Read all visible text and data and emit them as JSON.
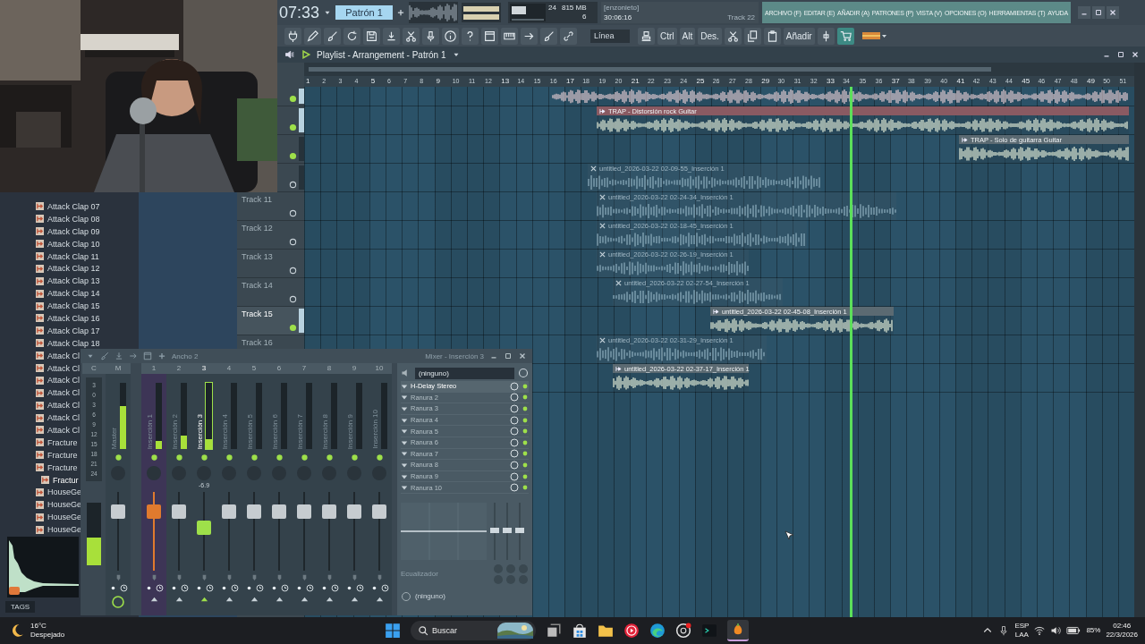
{
  "transport": {
    "time": "07:33",
    "pattern": "Patrón 1",
    "cpu": "24",
    "memory": "815 MB",
    "polyphony": "6"
  },
  "hint": {
    "user": "[enzonieto]",
    "time": "30:06:16",
    "track": "Track 22"
  },
  "menu": [
    "ARCHIVO (F)",
    "EDITAR (E)",
    "AÑADIR (A)",
    "PATRONES (P)",
    "VISTA (V)",
    "OPCIONES (O)",
    "HERRAMIENTAS (T)",
    "AYUDA"
  ],
  "toolbar": {
    "snap": "Línea",
    "buttons": [
      "Ctrl",
      "Alt",
      "Des.",
      "Añadir"
    ]
  },
  "playlist": {
    "title": "Playlist - Arrangement - Patrón 1",
    "ruler": [
      "1",
      "2",
      "3",
      "4",
      "5",
      "6",
      "7",
      "8",
      "9",
      "10",
      "11",
      "12",
      "13",
      "14",
      "15",
      "16",
      "17",
      "18",
      "19",
      "20",
      "21",
      "22",
      "23",
      "24",
      "25",
      "26",
      "27",
      "28",
      "29",
      "30",
      "31",
      "32",
      "33",
      "34",
      "35",
      "36",
      "37",
      "38",
      "39",
      "40",
      "41",
      "42",
      "43",
      "44",
      "45",
      "46",
      "47",
      "48",
      "49",
      "50",
      "51"
    ],
    "rows": [
      {
        "track": {
          "selected": true,
          "enabled": true
        },
        "clip": {
          "muted": false
        }
      },
      {
        "track": {
          "selected": true,
          "enabled": true
        },
        "clip": {
          "name": "TRAP - Distorsión rock Guitar",
          "muted": false,
          "color": "#8a5a62"
        }
      },
      {
        "track": {
          "selected": false,
          "enabled": true
        },
        "clip": {
          "name": "TRAP - Solo de guitarra Guitar",
          "muted": false,
          "color": "#5b6a72"
        }
      },
      {
        "track": {
          "selected": false,
          "enabled": false
        },
        "clip": {
          "name": "untitled_2026-03-22 02-09-55_Inserción 1",
          "muted": true
        }
      },
      {
        "track": {
          "name": "Track 11",
          "selected": false,
          "enabled": false
        },
        "clip": {
          "name": "untitled_2026-03-22 02-24-34_Inserción 1",
          "muted": true
        }
      },
      {
        "track": {
          "name": "Track 12",
          "selected": false,
          "enabled": false
        },
        "clip": {
          "name": "untitled_2026-03-22 02-18-45_Inserción 1",
          "muted": true
        }
      },
      {
        "track": {
          "name": "Track 13",
          "selected": false,
          "enabled": false
        },
        "clip": {
          "name": "untitled_2026-03-22 02-26-19_Inserción 1",
          "muted": true
        }
      },
      {
        "track": {
          "name": "Track 14",
          "selected": false,
          "enabled": false
        },
        "clip": {
          "name": "untitled_2026-03-22 02-27-54_Inserción 1",
          "muted": true
        }
      },
      {
        "track": {
          "name": "Track 15",
          "selected": true,
          "enabled": true
        },
        "clip": {
          "name": "untitled_2026-03-22 02-45-08_Inserción 1",
          "muted": false,
          "color": "#5b6a72"
        }
      },
      {
        "track": {
          "name": "Track 16",
          "selected": false
        },
        "clip": {
          "name": "untitled_2026-03-22 02-31-29_Inserción 1",
          "muted": true
        }
      },
      {
        "clip": {
          "name": "untitled_2026-03-22 02-37-17_Inserción 1",
          "muted": false,
          "color": "#5b6a72"
        }
      }
    ]
  },
  "browser": {
    "items": [
      {
        "name": "Attack Clap 07",
        "selected": false
      },
      {
        "name": "Attack Clap 08",
        "selected": false
      },
      {
        "name": "Attack Clap 09",
        "selected": false
      },
      {
        "name": "Attack Clap 10",
        "selected": false
      },
      {
        "name": "Attack Clap 11",
        "selected": false
      },
      {
        "name": "Attack Clap 12",
        "selected": false
      },
      {
        "name": "Attack Clap 13",
        "selected": false
      },
      {
        "name": "Attack Clap 14",
        "selected": false
      },
      {
        "name": "Attack Clap 15",
        "selected": false
      },
      {
        "name": "Attack Clap 16",
        "selected": false
      },
      {
        "name": "Attack Clap 17",
        "selected": false
      },
      {
        "name": "Attack Clap 18",
        "selected": false
      },
      {
        "name": "Attack Cl",
        "selected": false
      },
      {
        "name": "Attack Cl",
        "selected": false
      },
      {
        "name": "Attack Cl",
        "selected": false
      },
      {
        "name": "Attack Cl",
        "selected": false
      },
      {
        "name": "Attack Cl",
        "selected": false
      },
      {
        "name": "Attack Cl",
        "selected": false
      },
      {
        "name": "Attack Cl",
        "selected": false
      },
      {
        "name": "Fracture",
        "selected": false
      },
      {
        "name": "Fracture",
        "selected": false
      },
      {
        "name": "Fracture",
        "selected": false
      },
      {
        "name": "Fractur",
        "selected": true
      },
      {
        "name": "HouseGe",
        "selected": false
      },
      {
        "name": "HouseGe",
        "selected": false
      },
      {
        "name": "HouseGe",
        "selected": false
      },
      {
        "name": "HouseGe",
        "selected": false
      }
    ],
    "tags": "TAGS"
  },
  "mixer": {
    "width": "Ancho 2",
    "title": "Mixer - Inserción 3",
    "scale": {
      "label": "C",
      "ticks": [
        "3",
        "0",
        "3",
        "6",
        "9",
        "12",
        "15",
        "18",
        "21",
        "24"
      ],
      "meter": {
        "level": 0.45
      }
    },
    "strips": [
      {
        "number": "M",
        "name": "Master",
        "selected": false,
        "meter": {
          "level": 0.65
        },
        "fader": {
          "level": 0.8
        }
      },
      {
        "number": "1",
        "name": "Inserción 1",
        "selected": false,
        "color": "#e07a2e",
        "meter": {
          "level": 0.12
        },
        "fader": {
          "level": 0.8
        }
      },
      {
        "number": "2",
        "name": "Inserción 2",
        "selected": false,
        "meter": {
          "level": 0.2
        },
        "fader": {
          "level": 0.8
        }
      },
      {
        "number": "3",
        "name": "Inserción 3",
        "selected": true,
        "value": "-6.9",
        "meter": {
          "level": 0.15
        },
        "fader": {
          "level": 0.55
        }
      },
      {
        "number": "4",
        "name": "Inserción 4",
        "selected": false,
        "fader": {
          "level": 0.8
        }
      },
      {
        "number": "5",
        "name": "Inserción 5",
        "selected": false,
        "fader": {
          "level": 0.8
        }
      },
      {
        "number": "6",
        "name": "Inserción 6",
        "selected": false,
        "fader": {
          "level": 0.8
        }
      },
      {
        "number": "7",
        "name": "Inserción 7",
        "selected": false,
        "fader": {
          "level": 0.8
        }
      },
      {
        "number": "8",
        "name": "Inserción 8",
        "selected": false,
        "fader": {
          "level": 0.8
        }
      },
      {
        "number": "9",
        "name": "Inserción 9",
        "selected": false,
        "fader": {
          "level": 0.8
        }
      },
      {
        "number": "10",
        "name": "Inserción 10",
        "selected": false,
        "fader": {
          "level": 0.8
        }
      }
    ],
    "input": "(ninguno)",
    "slots": [
      {
        "name": "H-Delay Stereo",
        "active": true
      },
      {
        "name": "Ranura 2",
        "active": false
      },
      {
        "name": "Ranura 3",
        "active": false
      },
      {
        "name": "Ranura 4",
        "active": false
      },
      {
        "name": "Ranura 5",
        "active": false
      },
      {
        "name": "Ranura 6",
        "active": false
      },
      {
        "name": "Ranura 7",
        "active": false
      },
      {
        "name": "Ranura 8",
        "active": false
      },
      {
        "name": "Ranura 9",
        "active": false
      },
      {
        "name": "Ranura 10",
        "active": false
      }
    ],
    "eq_label": "Ecualizador",
    "output": "(ninguno)"
  },
  "taskbar": {
    "temp": "16°C",
    "weather": "Despejado",
    "search": {
      "placeholder": "Buscar"
    },
    "lang": "ESP",
    "region": "LAA",
    "battery": "85%",
    "time": "02:46",
    "date": "22/3/2026"
  }
}
